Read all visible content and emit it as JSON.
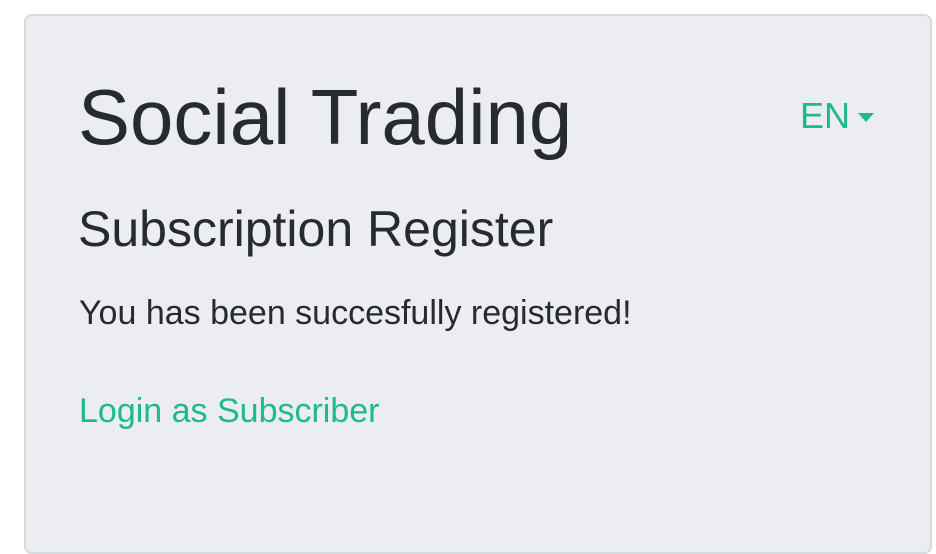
{
  "header": {
    "app_title": "Social Trading",
    "language": {
      "selected": "EN",
      "icon": "caret-down-icon"
    }
  },
  "main": {
    "heading": "Subscription Register",
    "message": "You has been succesfully registered!",
    "login_link": "Login as Subscriber"
  },
  "colors": {
    "accent": "#1fba8c",
    "text": "#272b30",
    "card_background": "#ebedf1"
  }
}
